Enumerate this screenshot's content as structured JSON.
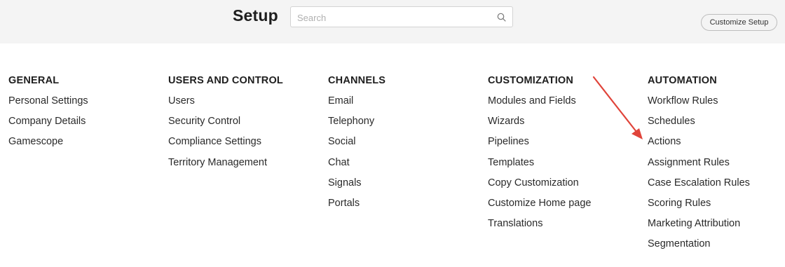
{
  "header": {
    "title": "Setup",
    "search_placeholder": "Search",
    "customize_button": "Customize Setup"
  },
  "columns": [
    {
      "heading": "GENERAL",
      "items": [
        "Personal Settings",
        "Company Details",
        "Gamescope"
      ]
    },
    {
      "heading": "USERS AND CONTROL",
      "items": [
        "Users",
        "Security Control",
        "Compliance Settings",
        "Territory Management"
      ]
    },
    {
      "heading": "CHANNELS",
      "items": [
        "Email",
        "Telephony",
        "Social",
        "Chat",
        "Signals",
        "Portals"
      ]
    },
    {
      "heading": "CUSTOMIZATION",
      "items": [
        "Modules and Fields",
        "Wizards",
        "Pipelines",
        "Templates",
        "Copy Customization",
        "Customize Home page",
        "Translations"
      ]
    },
    {
      "heading": "AUTOMATION",
      "items": [
        "Workflow Rules",
        "Schedules",
        "Actions",
        "Assignment Rules",
        "Case Escalation Rules",
        "Scoring Rules",
        "Marketing Attribution",
        "Segmentation"
      ]
    }
  ],
  "annotation": {
    "color": "#e0443a",
    "points_to": "Actions"
  }
}
